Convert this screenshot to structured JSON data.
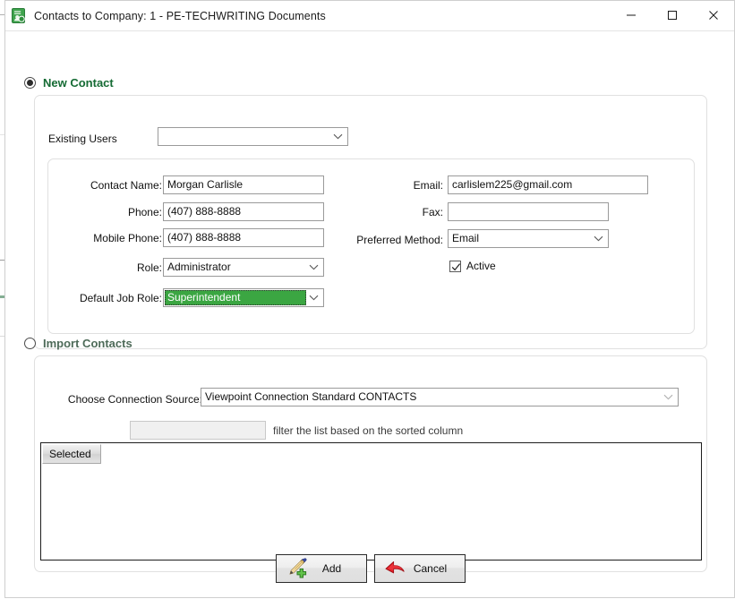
{
  "window": {
    "title": "Contacts to Company: 1 - PE-TECHWRITING Documents",
    "app_icon": "contacts-document-icon",
    "controls": {
      "minimize": "minimize-icon",
      "maximize": "maximize-icon",
      "close": "close-icon"
    }
  },
  "colors": {
    "accent_green": "#156b34",
    "selection_green": "#3ba642",
    "disabled_label": "#4e6b59",
    "grid_border": "#1d1d1d"
  },
  "new_contact": {
    "radio_label": "New Contact",
    "selected": true,
    "existing_users": {
      "label": "Existing Users",
      "value": "",
      "placeholder": ""
    },
    "fields": {
      "contact_name": {
        "label": "Contact Name:",
        "value": "Morgan Carlisle"
      },
      "phone": {
        "label": "Phone:",
        "value": "(407) 888-8888"
      },
      "mobile_phone": {
        "label": "Mobile Phone:",
        "value": "(407) 888-8888"
      },
      "role": {
        "label": "Role:",
        "value": "Administrator"
      },
      "default_job_role": {
        "label": "Default Job Role:",
        "value": "Superintendent",
        "highlighted": true
      },
      "email": {
        "label": "Email:",
        "value": "carlislem225@gmail.com"
      },
      "fax": {
        "label": "Fax:",
        "value": ""
      },
      "preferred_method": {
        "label": "Preferred Method:",
        "value": "Email"
      },
      "active": {
        "label": "Active",
        "checked": true
      }
    }
  },
  "import_contacts": {
    "radio_label": "Import Contacts",
    "selected": false,
    "connection_source": {
      "label": "Choose Connection Source:",
      "value": "Viewpoint Connection Standard CONTACTS"
    },
    "filter": {
      "value": "",
      "hint": "filter the list based on the sorted column"
    },
    "grid": {
      "columns": [
        "Selected"
      ],
      "rows": []
    }
  },
  "footer": {
    "add_button": {
      "label": "Add",
      "icon": "pen-plus-icon"
    },
    "cancel_button": {
      "label": "Cancel",
      "icon": "red-arrow-icon"
    }
  }
}
